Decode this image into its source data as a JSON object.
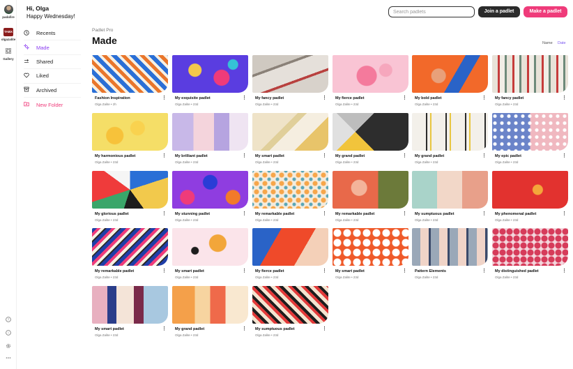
{
  "rail": {
    "user_label": "padafire",
    "org_logo": "TABX",
    "org_label": "olgazalite",
    "gallery_label": "Gallery",
    "bottom_icons": [
      "help-circle-icon",
      "info-circle-icon",
      "settings-icon",
      "more-icon"
    ]
  },
  "header": {
    "greeting": "Hi, Olga",
    "subgreeting": "Happy Wednesday!",
    "search_placeholder": "Search padlets",
    "join_label": "Join a padlet",
    "make_label": "Make a padlet"
  },
  "nav": {
    "items": [
      {
        "label": "Recents",
        "icon": "clock-icon"
      },
      {
        "label": "Made",
        "icon": "sparkle-icon"
      },
      {
        "label": "Shared",
        "icon": "share-icon"
      },
      {
        "label": "Liked",
        "icon": "heart-icon"
      },
      {
        "label": "Archived",
        "icon": "archive-icon"
      },
      {
        "label": "New Folder",
        "icon": "folder-plus-icon"
      }
    ]
  },
  "content": {
    "context": "Padlet Pro",
    "title": "Made",
    "sort_name": "Name",
    "sort_date": "Date"
  },
  "padlets": [
    {
      "title": "Fashion Inspiration",
      "meta": "Olga Zalite • 2h"
    },
    {
      "title": "My exquisite padlet",
      "meta": "Olga Zalite • 23d"
    },
    {
      "title": "My fancy padlet",
      "meta": "Olga Zalite • 23d"
    },
    {
      "title": "My fierce padlet",
      "meta": "Olga Zalite • 23d"
    },
    {
      "title": "My bold padlet",
      "meta": "Olga Zalite • 23d"
    },
    {
      "title": "My fancy padlet",
      "meta": "Olga Zalite • 23d"
    },
    {
      "title": "My harmonious padlet",
      "meta": "Olga Zalite • 23d"
    },
    {
      "title": "My brilliant padlet",
      "meta": "Olga Zalite • 23d"
    },
    {
      "title": "My smart padlet",
      "meta": "Olga Zalite • 23d"
    },
    {
      "title": "My grand padlet",
      "meta": "Olga Zalite • 23d"
    },
    {
      "title": "My grand padlet",
      "meta": "Olga Zalite • 23d"
    },
    {
      "title": "My epic padlet",
      "meta": "Olga Zalite • 23d"
    },
    {
      "title": "My glorious padlet",
      "meta": "Olga Zalite • 23d"
    },
    {
      "title": "My stunning padlet",
      "meta": "Olga Zalite • 23d"
    },
    {
      "title": "My remarkable padlet",
      "meta": "Olga Zalite • 23d"
    },
    {
      "title": "My remarkable padlet",
      "meta": "Olga Zalite • 23d"
    },
    {
      "title": "My sumptuous padlet",
      "meta": "Olga Zalite • 23d"
    },
    {
      "title": "My phenomenal padlet",
      "meta": "Olga Zalite • 23d"
    },
    {
      "title": "My remarkable padlet",
      "meta": "Olga Zalite • 23d"
    },
    {
      "title": "My smart padlet",
      "meta": "Olga Zalite • 23d"
    },
    {
      "title": "My fierce padlet",
      "meta": "Olga Zalite • 23d"
    },
    {
      "title": "My smart padlet",
      "meta": "Olga Zalite • 23d"
    },
    {
      "title": "Pattern Elements",
      "meta": "Olga Zalite • 23d"
    },
    {
      "title": "My distinguished padlet",
      "meta": "Olga Zalite • 23d"
    },
    {
      "title": "My smart padlet",
      "meta": "Olga Zalite • 23d"
    },
    {
      "title": "My grand padlet",
      "meta": "Olga Zalite • 23d"
    },
    {
      "title": "My sumptuous padlet",
      "meta": "Olga Zalite • 23d"
    }
  ],
  "card_menu_glyph": "⋮",
  "colors": {
    "accent_purple": "#8b3df0",
    "accent_pink": "#ef3b7a",
    "dark_button": "#2b2b2b"
  }
}
